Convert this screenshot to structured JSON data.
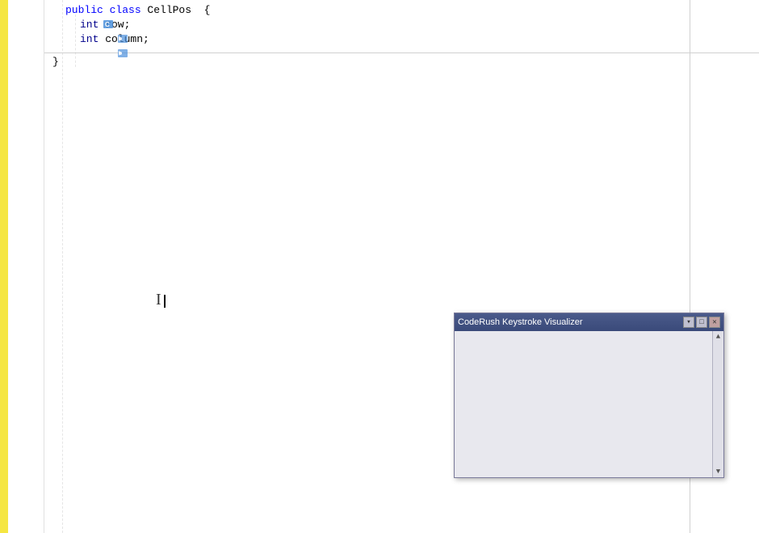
{
  "editor": {
    "background": "#ffffff",
    "code_lines": [
      {
        "id": 1,
        "indent": "",
        "icon": "class",
        "tokens": [
          {
            "text": "public class",
            "color": "blue"
          },
          {
            "text": " CellPos  {",
            "color": "black"
          }
        ]
      },
      {
        "id": 2,
        "indent": "  ",
        "icon": "field",
        "tokens": [
          {
            "text": "int",
            "color": "darkblue"
          },
          {
            "text": " row;",
            "color": "black"
          }
        ]
      },
      {
        "id": 3,
        "indent": "  ",
        "icon": "field",
        "tokens": [
          {
            "text": "int",
            "color": "darkblue"
          },
          {
            "text": " column;",
            "color": "black"
          }
        ]
      },
      {
        "id": 4,
        "indent": "",
        "icon": null,
        "tokens": [
          {
            "text": "}",
            "color": "black"
          }
        ]
      }
    ]
  },
  "coderush_window": {
    "title": "CodeRush Keystroke Visualizer",
    "buttons": {
      "minimize": "▾",
      "restore": "□",
      "close": "✕"
    }
  }
}
